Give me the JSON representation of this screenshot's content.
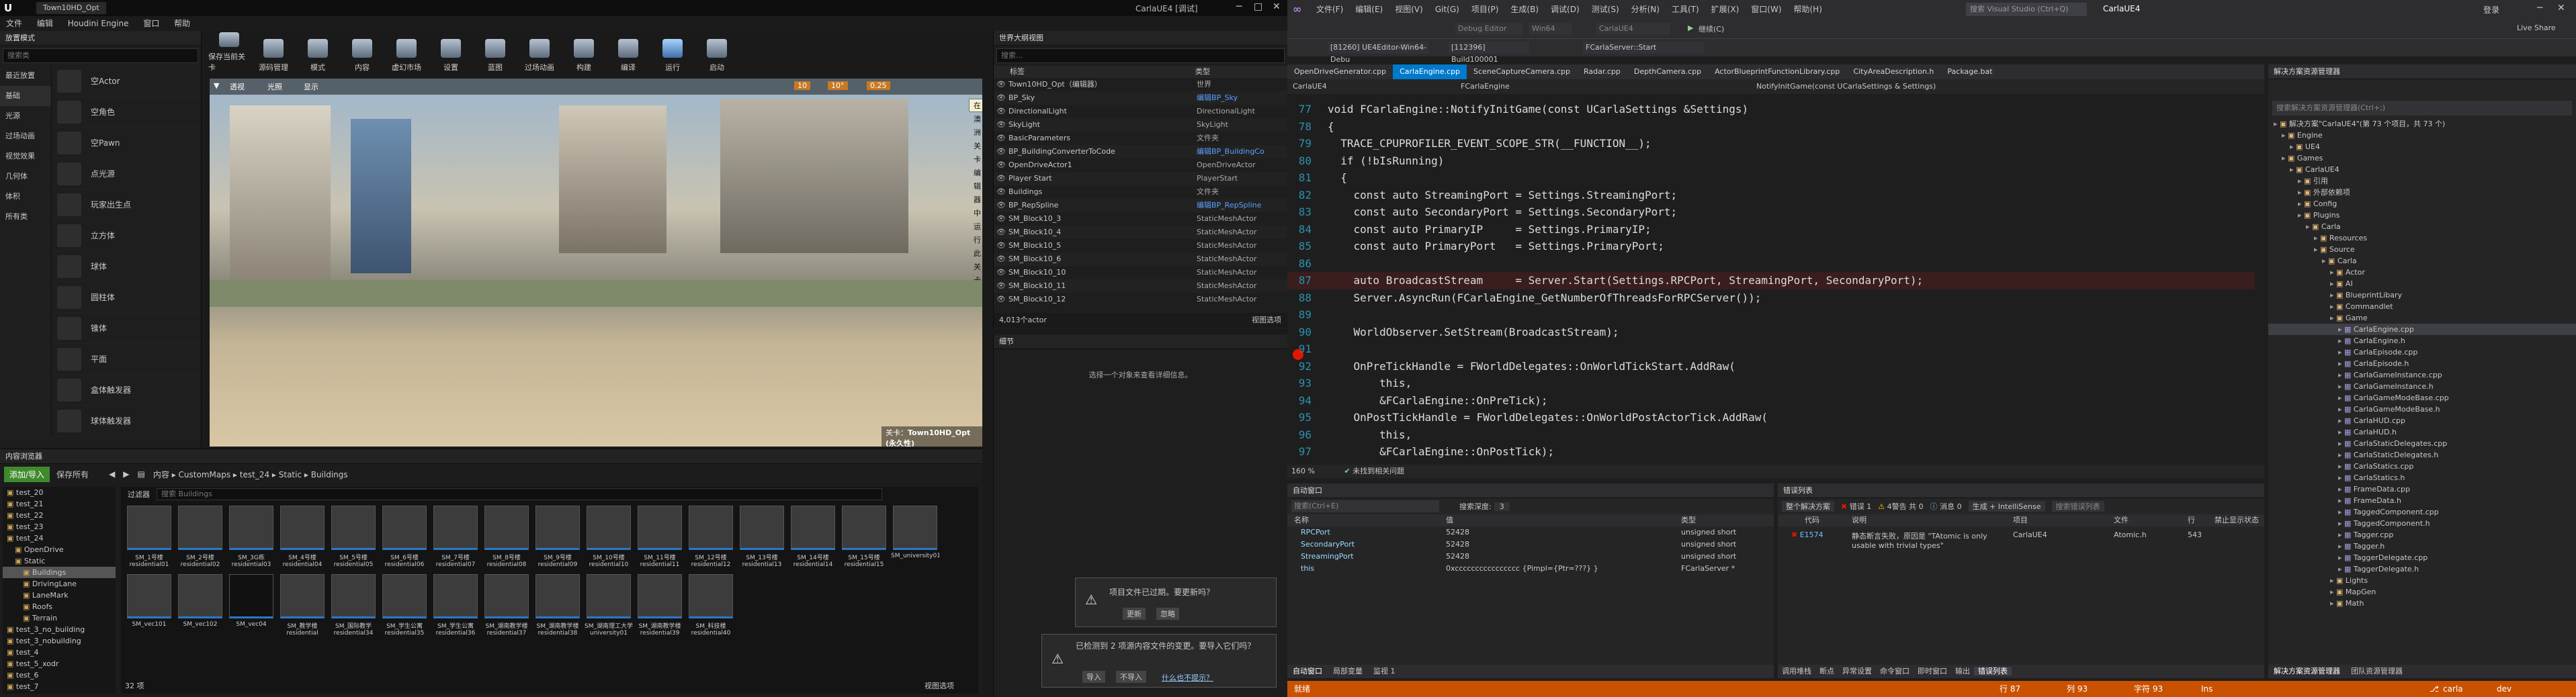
{
  "ue": {
    "title": "CarlaUE4 [调试]",
    "tab": "Town10HD_Opt",
    "menu": [
      "文件",
      "编辑",
      "Houdini Engine",
      "窗口",
      "帮助"
    ],
    "place_mode": "放置模式",
    "search_placeholder": "搜索类",
    "categories": [
      "最近放置",
      "基础",
      "光源",
      "过场动画",
      "视觉效果",
      "几何体",
      "体积",
      "所有类"
    ],
    "objects": [
      "空Actor",
      "空角色",
      "空Pawn",
      "点光源",
      "玩家出生点",
      "立方体",
      "球体",
      "圆柱体",
      "锥体",
      "平面",
      "盒体触发器",
      "球体触发器"
    ],
    "toolbar": [
      "保存当前关卡",
      "源码管理",
      "模式",
      "内容",
      "虚幻市场",
      "设置",
      "蓝图",
      "过场动画",
      "构建",
      "编译",
      "运行",
      "启动"
    ],
    "viewport_menu": [
      "透视",
      "光照",
      "显示"
    ],
    "viewport_snap": [
      "10",
      "10°",
      "0.25"
    ],
    "viewport_tooltip": "在澳洲关卡编辑器中运行此关卡",
    "viewport_level": "关卡：",
    "viewport_level_name": "Town10HD_Opt (永久性)",
    "outliner_title": "世界大纲视图",
    "outliner_search": "搜索...",
    "outliner_cols": [
      "标签",
      "类型"
    ],
    "outliner_rows": [
      {
        "n": "Town10HD_Opt（编辑器）",
        "t": "世界"
      },
      {
        "n": "BP_Sky",
        "t": "编辑BP_Sky"
      },
      {
        "n": "DirectionalLight",
        "t": "DirectionalLight"
      },
      {
        "n": "SkyLight",
        "t": "SkyLight"
      },
      {
        "n": "BasicParameters",
        "t": "文件夹"
      },
      {
        "n": "BP_BuildingConverterToCode",
        "t": "编辑BP_BuildingCo"
      },
      {
        "n": "OpenDriveActor1",
        "t": "OpenDriveActor"
      },
      {
        "n": "Player Start",
        "t": "PlayerStart"
      },
      {
        "n": "Buildings",
        "t": "文件夹"
      },
      {
        "n": "BP_RepSpline",
        "t": "编辑BP_RepSpline"
      },
      {
        "n": "SM_Block10_3",
        "t": "StaticMeshActor"
      },
      {
        "n": "SM_Block10_4",
        "t": "StaticMeshActor"
      },
      {
        "n": "SM_Block10_5",
        "t": "StaticMeshActor"
      },
      {
        "n": "SM_Block10_6",
        "t": "StaticMeshActor"
      },
      {
        "n": "SM_Block10_10",
        "t": "StaticMeshActor"
      },
      {
        "n": "SM_Block10_11",
        "t": "StaticMeshActor"
      },
      {
        "n": "SM_Block10_12",
        "t": "StaticMeshActor"
      }
    ],
    "outliner_count": "4,013个actor",
    "view_options": "视图选项",
    "details_title": "细节",
    "details_empty": "选择一个对象来查看详细信息。",
    "content_title": "内容浏览器",
    "add_import": "添加/导入",
    "save_all": "保存所有",
    "breadcrumb": [
      "内容",
      "CustomMaps",
      "test_24",
      "Static",
      "Buildings"
    ],
    "filter": "过滤器",
    "content_search": "搜索 Buildings",
    "folders": [
      "test_20",
      "test_21",
      "test_22",
      "test_23",
      "test_24",
      "OpenDrive",
      "Static",
      "Buildings",
      "DrivingLane",
      "LaneMark",
      "Roofs",
      "Terrain",
      "test_3_no_building",
      "test_3_nobuilding",
      "test_4",
      "test_5_xodr",
      "test_6",
      "test_7"
    ],
    "assets_row1": [
      "SM_1号楼residential01",
      "SM_2号楼residential02",
      "SM_3G栋residential03",
      "SM_4号楼residential04",
      "SM_5号楼residential05",
      "SM_6号楼residential06",
      "SM_7号楼residential07",
      "SM_8号楼residential08",
      "SM_9号楼residential09",
      "SM_10号楼residential10",
      "SM_11号楼residential11",
      "SM_12号楼residential12",
      "SM_13号楼residential13",
      "SM_14号楼residential14",
      "SM_15号楼residential15"
    ],
    "assets_row2": [
      "SM_university01",
      "SM_vec101",
      "SM_vec102",
      "SM_vec04",
      "SM_教学楼residential",
      "SM_国际教学residential34",
      "SM_学生公寓residential35",
      "SM_学生公寓residential36",
      "SM_湖南教学楼residential37",
      "SM_湖南教学楼residential38",
      "SM_湖南理工大学university01",
      "SM_湖南教学楼residential39",
      "SM_科技楼residential40"
    ],
    "asset_count": "32 项",
    "notice1": "项目文件已过期。要更新吗？",
    "notice1_btns": [
      "更新",
      "忽略"
    ],
    "notice2": "已检测到 2 项源内容文件的变更。要导入它们吗？",
    "notice2_btns": [
      "导入",
      "不导入",
      "什么也不提示？"
    ]
  },
  "vs": {
    "menu": [
      "文件(F)",
      "编辑(E)",
      "视图(V)",
      "Git(G)",
      "项目(P)",
      "生成(B)",
      "调试(D)",
      "测试(S)",
      "分析(N)",
      "工具(T)",
      "扩展(X)",
      "窗口(W)",
      "帮助(H)"
    ],
    "search": "搜索 Visual Studio (Ctrl+Q)",
    "solution_name": "CarlaUE4",
    "config": "Debug Editor",
    "platform": "Win64",
    "startup": "CarlaUE4",
    "run": "继续(C)",
    "live_share": "Live Share",
    "login": "登录",
    "process": "[81260] UE4Editor-Win64-Debu",
    "thread": "[112396] Build100001",
    "stack": "FCarlaServer::Start",
    "file_tabs": [
      "OpenDriveGenerator.cpp",
      "CarlaEngine.cpp",
      "SceneCaptureCamera.cpp",
      "Radar.cpp",
      "DepthCamera.cpp",
      "ActorBlueprintFunctionLibrary.cpp",
      "CityAreaDescription.h",
      "Package.bat"
    ],
    "nav_project": "CarlaUE4",
    "nav_class": "FCarlaEngine",
    "nav_member": "NotifyInitGame(const UCarlaSettings & Settings)",
    "code_lines": [
      {
        "n": "77",
        "t": "void FCarlaEngine::NotifyInitGame(const UCarlaSettings &Settings)"
      },
      {
        "n": "78",
        "t": "{"
      },
      {
        "n": "79",
        "t": "  TRACE_CPUPROFILER_EVENT_SCOPE_STR(__FUNCTION__);"
      },
      {
        "n": "80",
        "t": "  if (!bIsRunning)"
      },
      {
        "n": "81",
        "t": "  {"
      },
      {
        "n": "82",
        "t": "    const auto StreamingPort = Settings.StreamingPort;"
      },
      {
        "n": "83",
        "t": "    const auto SecondaryPort = Settings.SecondaryPort;"
      },
      {
        "n": "84",
        "t": "    const auto PrimaryIP     = Settings.PrimaryIP;"
      },
      {
        "n": "85",
        "t": "    const auto PrimaryPort   = Settings.PrimaryPort;"
      },
      {
        "n": "86",
        "t": ""
      },
      {
        "n": "87",
        "t": "    auto BroadcastStream     = Server.Start(Settings.RPCPort, StreamingPort, SecondaryPort);"
      },
      {
        "n": "88",
        "t": "    Server.AsyncRun(FCarlaEngine_GetNumberOfThreadsForRPCServer());"
      },
      {
        "n": "89",
        "t": ""
      },
      {
        "n": "90",
        "t": "    WorldObserver.SetStream(BroadcastStream);"
      },
      {
        "n": "91",
        "t": ""
      },
      {
        "n": "92",
        "t": "    OnPreTickHandle = FWorldDelegates::OnWorldTickStart.AddRaw("
      },
      {
        "n": "93",
        "t": "        this,"
      },
      {
        "n": "94",
        "t": "        &FCarlaEngine::OnPreTick);"
      },
      {
        "n": "95",
        "t": "    OnPostTickHandle = FWorldDelegates::OnWorldPostActorTick.AddRaw("
      },
      {
        "n": "96",
        "t": "        this,"
      },
      {
        "n": "97",
        "t": "        &FCarlaEngine::OnPostTick);"
      }
    ],
    "zoom": "160 %",
    "code_status": "未找到相关问题",
    "autos_title": "自动窗口",
    "autos_search": "搜索(Ctrl+E)",
    "autos_depth_label": "搜索深度:",
    "autos_depth": "3",
    "autos_cols": [
      "名称",
      "值",
      "类型"
    ],
    "autos": [
      {
        "n": "RPCPort",
        "v": "52428",
        "t": "unsigned short"
      },
      {
        "n": "SecondaryPort",
        "v": "52428",
        "t": "unsigned short"
      },
      {
        "n": "StreamingPort",
        "v": "52428",
        "t": "unsigned short"
      },
      {
        "n": "this",
        "v": "0xcccccccccccccccc {Pimpl={Ptr=???} }",
        "t": "FCarlaServer *"
      }
    ],
    "autos_tabs": [
      "自动窗口",
      "局部变量",
      "监视 1"
    ],
    "errors_title": "错误列表",
    "errors_scope": "整个解决方案",
    "errors_count": "错误 1",
    "warnings_count": "4警告 共 0",
    "messages_count": "消息 0",
    "build_filter": "生成 + IntelliSense",
    "errors_search": "搜索错误列表",
    "errors_cols": [
      "代码",
      "说明",
      "项目",
      "文件",
      "行",
      "禁止显示状态"
    ],
    "error_row": {
      "code": "E1574",
      "desc": "静态断言失败，原因是 \"TAtomic is only usable with trivial types\"",
      "project": "CarlaUE4",
      "file": "Atomic.h",
      "line": "543"
    },
    "errors_tabs": [
      "调用堆栈",
      "断点",
      "异常设置",
      "命令窗口",
      "即时窗口",
      "输出",
      "错误列表"
    ],
    "se_title": "解决方案资源管理器",
    "se_search": "搜索解决方案资源管理器(Ctrl+;)",
    "se_tree": [
      {
        "d": 0,
        "n": "解决方案\"CarlaUE4\"(第 73 个项目，共 73 个)"
      },
      {
        "d": 1,
        "n": "Engine"
      },
      {
        "d": 2,
        "n": "UE4"
      },
      {
        "d": 1,
        "n": "Games"
      },
      {
        "d": 2,
        "n": "CarlaUE4"
      },
      {
        "d": 3,
        "n": "引用"
      },
      {
        "d": 3,
        "n": "外部依赖项"
      },
      {
        "d": 3,
        "n": "Config"
      },
      {
        "d": 3,
        "n": "Plugins"
      },
      {
        "d": 4,
        "n": "Carla"
      },
      {
        "d": 5,
        "n": "Resources"
      },
      {
        "d": 5,
        "n": "Source"
      },
      {
        "d": 6,
        "n": "Carla"
      },
      {
        "d": 7,
        "n": "Actor"
      },
      {
        "d": 7,
        "n": "AI"
      },
      {
        "d": 7,
        "n": "BlueprintLibary"
      },
      {
        "d": 7,
        "n": "Commandlet"
      },
      {
        "d": 7,
        "n": "Game"
      },
      {
        "d": 8,
        "n": "CarlaEngine.cpp"
      },
      {
        "d": 8,
        "n": "CarlaEngine.h"
      },
      {
        "d": 8,
        "n": "CarlaEpisode.cpp"
      },
      {
        "d": 8,
        "n": "CarlaEpisode.h"
      },
      {
        "d": 8,
        "n": "CarlaGameInstance.cpp"
      },
      {
        "d": 8,
        "n": "CarlaGameInstance.h"
      },
      {
        "d": 8,
        "n": "CarlaGameModeBase.cpp"
      },
      {
        "d": 8,
        "n": "CarlaGameModeBase.h"
      },
      {
        "d": 8,
        "n": "CarlaHUD.cpp"
      },
      {
        "d": 8,
        "n": "CarlaHUD.h"
      },
      {
        "d": 8,
        "n": "CarlaStaticDelegates.cpp"
      },
      {
        "d": 8,
        "n": "CarlaStaticDelegates.h"
      },
      {
        "d": 8,
        "n": "CarlaStatics.cpp"
      },
      {
        "d": 8,
        "n": "CarlaStatics.h"
      },
      {
        "d": 8,
        "n": "FrameData.cpp"
      },
      {
        "d": 8,
        "n": "FrameData.h"
      },
      {
        "d": 8,
        "n": "TaggedComponent.cpp"
      },
      {
        "d": 8,
        "n": "TaggedComponent.h"
      },
      {
        "d": 8,
        "n": "Tagger.cpp"
      },
      {
        "d": 8,
        "n": "Tagger.h"
      },
      {
        "d": 8,
        "n": "TaggerDelegate.cpp"
      },
      {
        "d": 8,
        "n": "TaggerDelegate.h"
      },
      {
        "d": 7,
        "n": "Lights"
      },
      {
        "d": 7,
        "n": "MapGen"
      },
      {
        "d": 7,
        "n": "Math"
      }
    ],
    "se_tabs": [
      "解决方案资源管理器",
      "团队资源管理器"
    ],
    "status_ready": "就绪",
    "status_line": "行 87",
    "status_col": "列 93",
    "status_char": "字符 93",
    "status_ins": "Ins",
    "status_branch": "carla",
    "status_repo": "dev",
    "accent": "#007acc",
    "status_bar_color": "#ca5100"
  }
}
